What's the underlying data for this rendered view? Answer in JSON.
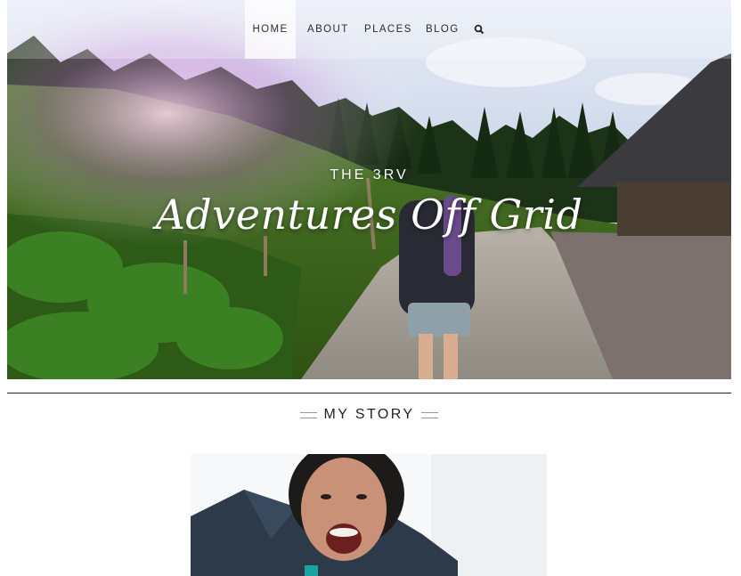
{
  "nav": {
    "items": [
      {
        "label": "HOME",
        "active": true
      },
      {
        "label": "ABOUT",
        "active": false
      },
      {
        "label": "PLACES",
        "active": false
      },
      {
        "label": "BLOG",
        "active": false
      }
    ],
    "search_icon": "search-icon"
  },
  "hero": {
    "kicker": "THE 3RV",
    "title": "Adventures Off Grid"
  },
  "section": {
    "title": "MY STORY"
  },
  "colors": {
    "text_dark": "#222222",
    "divider": "#222222",
    "sky": "#cfd9ea",
    "grass": "#3e6b1e",
    "path": "#9a948c"
  }
}
